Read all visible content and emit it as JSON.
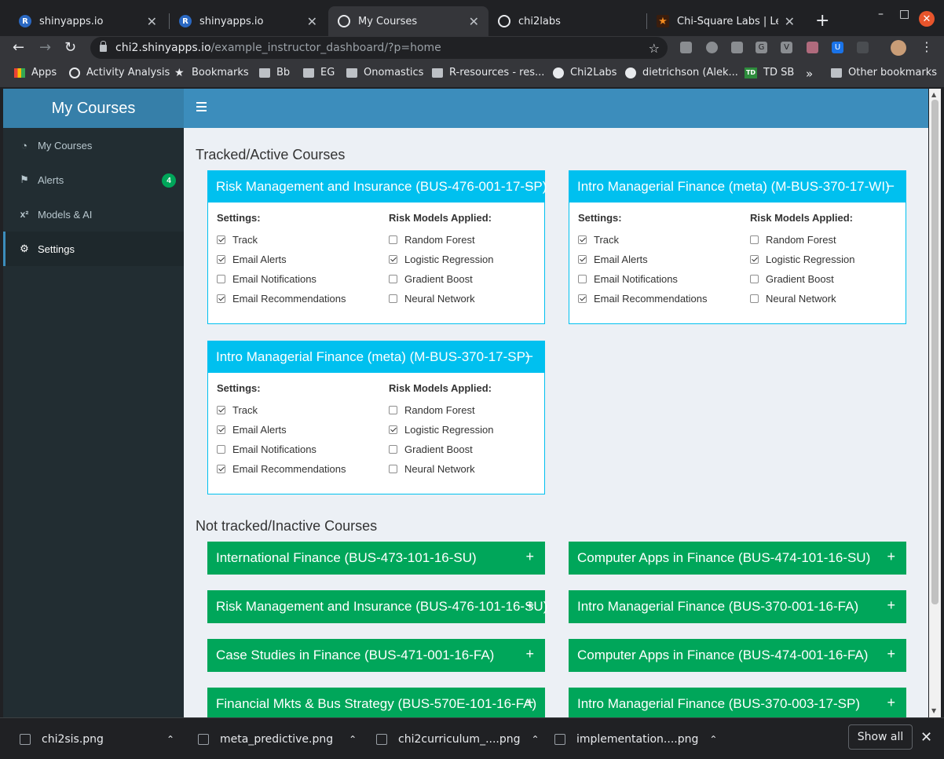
{
  "browser": {
    "tabs": [
      {
        "title": "shinyapps.io",
        "icon": "r-icon",
        "icon_glyph": "R"
      },
      {
        "title": "shinyapps.io",
        "icon": "r-icon",
        "icon_glyph": "R"
      },
      {
        "title": "My Courses",
        "icon": "globe-icon"
      },
      {
        "title": "chi2labs",
        "icon": "globe-icon"
      },
      {
        "title": "Chi-Square Labs | Learr",
        "icon": "star-icon",
        "icon_glyph": "★"
      }
    ],
    "new_tab_glyph": "+",
    "minimize_glyph": "–",
    "maximize_glyph": "□",
    "close_glyph": "✕",
    "back_glyph": "←",
    "forward_glyph": "→",
    "reload_glyph": "↻",
    "url_host": "chi2.shinyapps.io",
    "url_path": "/example_instructor_dashboard/?p=home",
    "star_glyph": "☆",
    "menu_glyph": "⋮",
    "extensions": [
      {
        "name": "cast-extension-icon",
        "glyph": ""
      },
      {
        "name": "record-extension-icon",
        "glyph": ""
      },
      {
        "name": "bulb-extension-icon",
        "glyph": ""
      },
      {
        "name": "g-extension-icon",
        "glyph": "G"
      },
      {
        "name": "v-extension-icon",
        "glyph": "V"
      },
      {
        "name": "bug-extension-icon",
        "glyph": ""
      },
      {
        "name": "u-extension-icon",
        "glyph": "U"
      },
      {
        "name": "puzzle-extension-icon",
        "glyph": ""
      }
    ],
    "bookmarks": [
      {
        "label": "Apps",
        "icon": "apps-grid-icon"
      },
      {
        "label": "Activity Analysis",
        "icon": "globe-icon"
      },
      {
        "label": "Bookmarks",
        "icon": "star-icon",
        "icon_glyph": "★"
      },
      {
        "label": "Bb",
        "icon": "folder-icon"
      },
      {
        "label": "EG",
        "icon": "folder-icon"
      },
      {
        "label": "Onomastics",
        "icon": "folder-icon"
      },
      {
        "label": "R-resources - res...",
        "icon": "folder-icon"
      },
      {
        "label": "Chi2Labs",
        "icon": "github-icon"
      },
      {
        "label": "dietrichson (Alek...",
        "icon": "github-icon"
      },
      {
        "label": "TD SB",
        "icon": "td-icon",
        "icon_glyph": "TD"
      }
    ],
    "bookmarks_overflow": "»",
    "other_bookmarks": "Other bookmarks"
  },
  "app": {
    "brand": "My Courses",
    "sidebar": [
      {
        "label": "My Courses",
        "icon": "dashboard-icon",
        "glyph": "◔"
      },
      {
        "label": "Alerts",
        "icon": "flag-icon",
        "glyph": "⚑",
        "badge": "4"
      },
      {
        "label": "Models & AI",
        "icon": "superscript-icon",
        "glyph": "x²"
      },
      {
        "label": "Settings",
        "icon": "gear-icon",
        "glyph": "⚙",
        "active": true
      }
    ],
    "tracked_title": "Tracked/Active Courses",
    "untracked_title": "Not tracked/Inactive Courses",
    "settings_label": "Settings:",
    "models_label": "Risk Models Applied:",
    "collapse_glyph": "−",
    "expand_glyph": "+",
    "tracked": [
      {
        "title": "Risk Management and Insurance (BUS-476-001-17-SP)",
        "settings": [
          {
            "label": "Track",
            "checked": true
          },
          {
            "label": "Email Alerts",
            "checked": true
          },
          {
            "label": "Email Notifications",
            "checked": false
          },
          {
            "label": "Email Recommendations",
            "checked": true
          }
        ],
        "models": [
          {
            "label": "Random Forest",
            "checked": false
          },
          {
            "label": "Logistic Regression",
            "checked": true
          },
          {
            "label": "Gradient Boost",
            "checked": false
          },
          {
            "label": "Neural Network",
            "checked": false
          }
        ]
      },
      {
        "title": "Intro Managerial Finance (meta) (M-BUS-370-17-WI)",
        "settings": [
          {
            "label": "Track",
            "checked": true
          },
          {
            "label": "Email Alerts",
            "checked": true
          },
          {
            "label": "Email Notifications",
            "checked": false
          },
          {
            "label": "Email Recommendations",
            "checked": true
          }
        ],
        "models": [
          {
            "label": "Random Forest",
            "checked": false
          },
          {
            "label": "Logistic Regression",
            "checked": true
          },
          {
            "label": "Gradient Boost",
            "checked": false
          },
          {
            "label": "Neural Network",
            "checked": false
          }
        ]
      },
      {
        "title": "Intro Managerial Finance (meta) (M-BUS-370-17-SP)",
        "settings": [
          {
            "label": "Track",
            "checked": true
          },
          {
            "label": "Email Alerts",
            "checked": true
          },
          {
            "label": "Email Notifications",
            "checked": false
          },
          {
            "label": "Email Recommendations",
            "checked": true
          }
        ],
        "models": [
          {
            "label": "Random Forest",
            "checked": false
          },
          {
            "label": "Logistic Regression",
            "checked": true
          },
          {
            "label": "Gradient Boost",
            "checked": false
          },
          {
            "label": "Neural Network",
            "checked": false
          }
        ]
      }
    ],
    "untracked": [
      "International Finance (BUS-473-101-16-SU)",
      "Computer Apps in Finance (BUS-474-101-16-SU)",
      "Risk Management and Insurance (BUS-476-101-16-SU)",
      "Intro Managerial Finance (BUS-370-001-16-FA)",
      "Case Studies in Finance (BUS-471-001-16-FA)",
      "Computer Apps in Finance (BUS-474-001-16-FA)",
      "Financial Mkts & Bus Strategy (BUS-570E-101-16-FA)",
      "Intro Managerial Finance (BUS-370-003-17-SP)"
    ]
  },
  "downloads": {
    "files": [
      "chi2sis.png",
      "meta_predictive.png",
      "chi2curriculum_....png",
      "implementation....png"
    ],
    "chevron_glyph": "⌃",
    "show_all": "Show all",
    "close_glyph": "✕"
  },
  "colors": {
    "header_blue": "#3c8dbc",
    "brand_blue": "#367fa9",
    "box_cyan": "#00c0ef",
    "box_green": "#00a65a",
    "sidebar_dark": "#222d32"
  }
}
